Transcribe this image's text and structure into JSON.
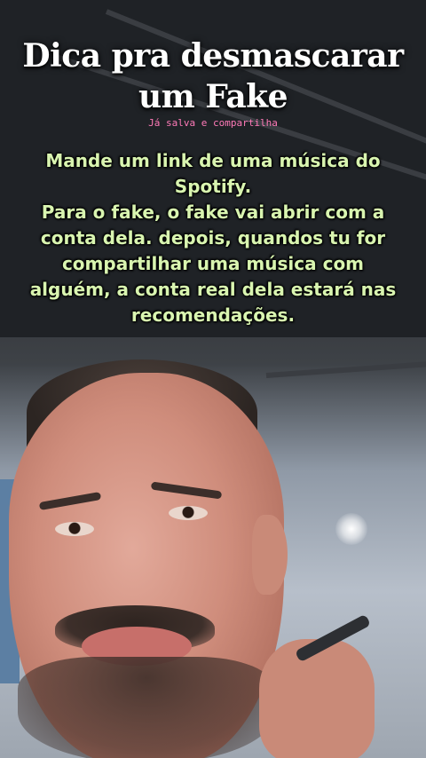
{
  "overlay": {
    "title_line1": "Dica pra desmascarar",
    "title_line2": "um Fake",
    "subtitle": "Já salva e compartilha",
    "body_lines": [
      "Mande um link de uma música do",
      "Spotify.",
      "Para o fake, o fake vai abrir com a",
      "conta dela. depois, quandos tu for",
      "compartilhar uma música com",
      "alguém, a conta real dela estará nas",
      "recomendações."
    ]
  },
  "colors": {
    "title": "#ffffff",
    "subtitle": "#ff7ab8",
    "body": "#d9f5b0"
  }
}
